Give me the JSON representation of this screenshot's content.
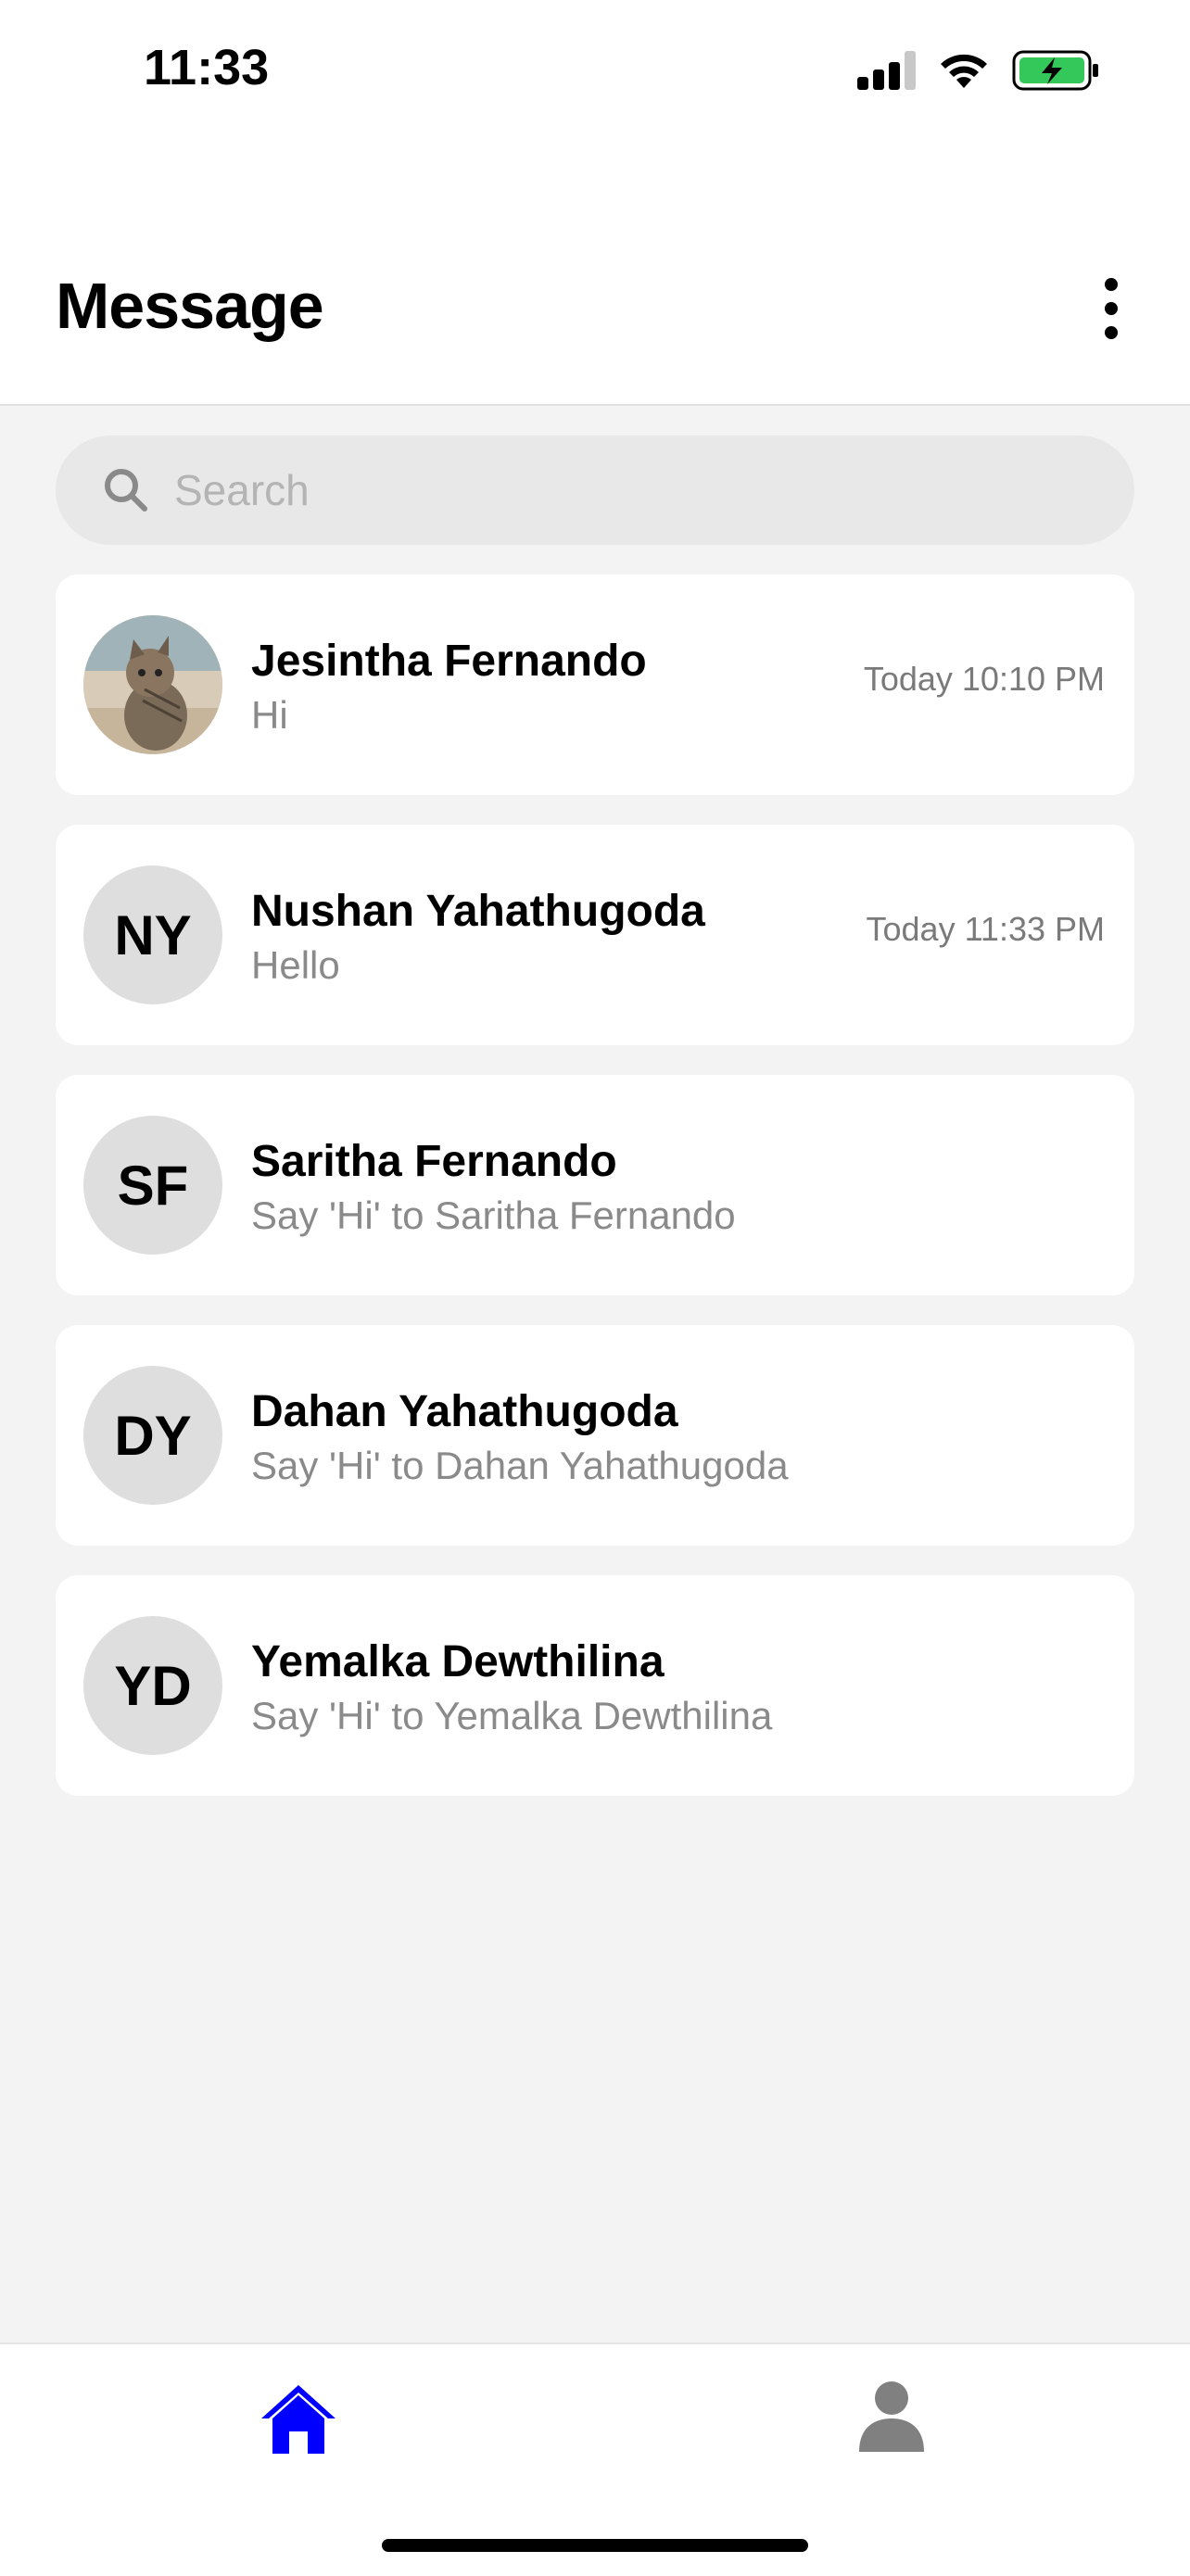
{
  "status_bar": {
    "time": "11:33",
    "icons": [
      "cellular-signal-icon",
      "wifi-icon",
      "battery-charging-icon"
    ],
    "battery_color": "#34c759"
  },
  "header": {
    "title": "Message",
    "menu_icon": "more-vertical-icon"
  },
  "search": {
    "placeholder": "Search",
    "value": "",
    "icon": "search-icon"
  },
  "conversations": [
    {
      "name": "Jesintha Fernando",
      "preview": "Hi",
      "time": "Today 10:10 PM",
      "avatar_type": "photo",
      "avatar_description": "kitten-photo"
    },
    {
      "name": "Nushan Yahathugoda",
      "preview": "Hello",
      "time": "Today 11:33 PM",
      "initials": "NY"
    },
    {
      "name": "Saritha Fernando",
      "preview": "Say 'Hi' to Saritha Fernando",
      "time": "",
      "initials": "SF"
    },
    {
      "name": "Dahan Yahathugoda",
      "preview": "Say 'Hi' to Dahan Yahathugoda",
      "time": "",
      "initials": "DY"
    },
    {
      "name": "Yemalka Dewthilina",
      "preview": "Say 'Hi' to Yemalka Dewthilina",
      "time": "",
      "initials": "YD"
    }
  ],
  "tab_bar": {
    "tabs": [
      {
        "icon": "home-icon",
        "active": true,
        "color": "#0000ff"
      },
      {
        "icon": "person-icon",
        "active": false,
        "color": "#808080"
      }
    ]
  }
}
